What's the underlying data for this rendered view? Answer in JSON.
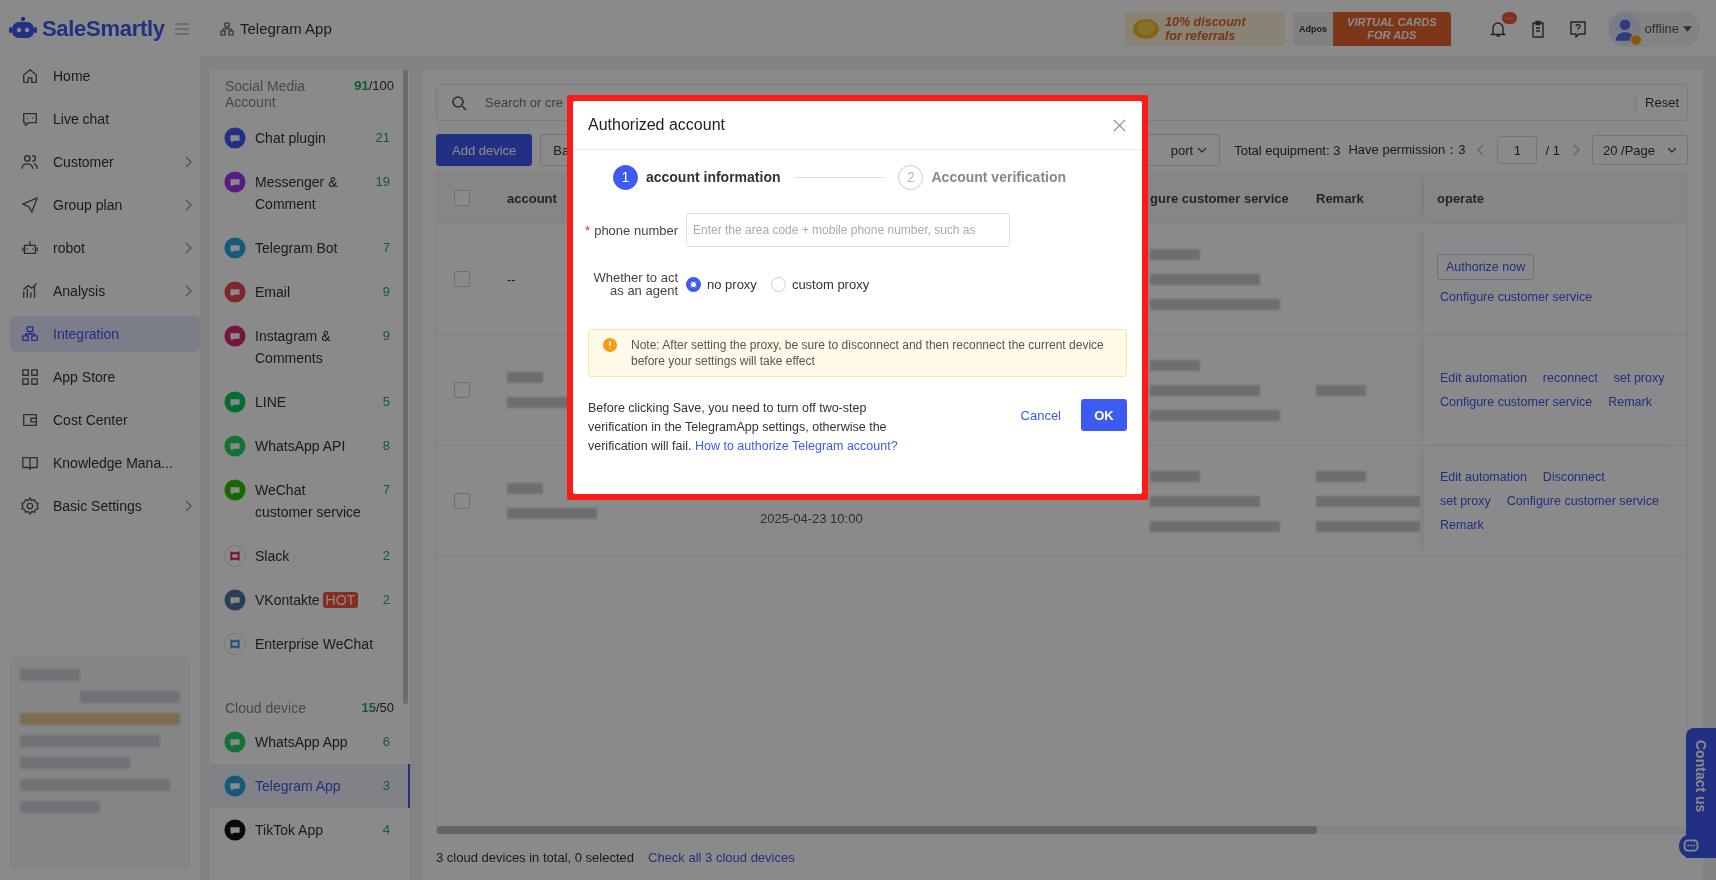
{
  "app": {
    "logo": "SaleSmartly"
  },
  "nav": [
    {
      "label": "Home",
      "expandable": false,
      "selected": false
    },
    {
      "label": "Live chat",
      "expandable": false,
      "selected": false
    },
    {
      "label": "Customer",
      "expandable": true,
      "selected": false
    },
    {
      "label": "Group plan",
      "expandable": true,
      "selected": false
    },
    {
      "label": "robot",
      "expandable": true,
      "selected": false
    },
    {
      "label": "Analysis",
      "expandable": true,
      "selected": false
    },
    {
      "label": "Integration",
      "expandable": false,
      "selected": true
    },
    {
      "label": "App Store",
      "expandable": false,
      "selected": false
    },
    {
      "label": "Cost Center",
      "expandable": false,
      "selected": false
    },
    {
      "label": "Knowledge Mana...",
      "expandable": false,
      "selected": false
    },
    {
      "label": "Basic Settings",
      "expandable": true,
      "selected": false
    }
  ],
  "top_bar": {
    "breadcrumb": "Telegram App",
    "promo_referral": [
      "10% discount",
      "for referrals"
    ],
    "promo_brand": "Adpos",
    "promo_cards": [
      "VIRTUAL CARDS",
      "FOR ADS"
    ],
    "notification_badge": "···",
    "user_status": "offline"
  },
  "channel_groups": [
    {
      "title": "Social Media Account",
      "count": "91",
      "limit": "/100",
      "items": [
        {
          "name": "Chat plugin",
          "count": "21",
          "selected": false
        },
        {
          "name": "Messenger & Comment",
          "count": "19",
          "selected": false
        },
        {
          "name": "Telegram Bot",
          "count": "7",
          "selected": false
        },
        {
          "name": "Email",
          "count": "9",
          "selected": false
        },
        {
          "name": "Instagram & Comments",
          "count": "9",
          "selected": false
        },
        {
          "name": "LINE",
          "count": "5",
          "selected": false
        },
        {
          "name": "WhatsApp API",
          "count": "8",
          "selected": false
        },
        {
          "name": "WeChat customer service",
          "count": "7",
          "selected": false
        },
        {
          "name": "Slack",
          "count": "2",
          "selected": false
        },
        {
          "name": "VKontakte",
          "badge": "HOT",
          "count": "2",
          "selected": false
        },
        {
          "name": "Enterprise WeChat",
          "selected": false
        }
      ]
    },
    {
      "title": "Cloud device",
      "count": "15",
      "limit": "/50",
      "items": [
        {
          "name": "WhatsApp App",
          "count": "6",
          "selected": false
        },
        {
          "name": "Telegram App",
          "count": "3",
          "selected": true
        },
        {
          "name": "TikTok App",
          "count": "4",
          "selected": false
        }
      ]
    }
  ],
  "toolbar": {
    "search_placeholder": "Search or cre",
    "reset": "Reset",
    "add_device": "Add device",
    "batch": "Ba",
    "export": "port",
    "total": "Total equipment: 3",
    "permission": "Have permission：3",
    "page": "1",
    "pages": "/ 1",
    "page_size": "20 /Page"
  },
  "table": {
    "all_checked": false,
    "columns": [
      "account",
      "gure customer service",
      "Remark",
      "operate"
    ],
    "rows": [
      {
        "checked": false,
        "account": "--",
        "actions": [
          [
            {
              "label": "Authorize now",
              "kind": "button"
            }
          ],
          [
            {
              "label": "Configure customer service",
              "kind": "link"
            }
          ]
        ]
      },
      {
        "checked": false,
        "actions": [
          [
            {
              "label": "Edit automation",
              "kind": "link"
            },
            {
              "label": "reconnect",
              "kind": "link"
            },
            {
              "label": "set proxy",
              "kind": "link"
            }
          ],
          [
            {
              "label": "Configure customer service",
              "kind": "link"
            },
            {
              "label": "Remark",
              "kind": "link"
            }
          ]
        ]
      },
      {
        "checked": false,
        "date": "2025-04-23 10:00",
        "actions": [
          [
            {
              "label": "Edit automation",
              "kind": "link"
            },
            {
              "label": "Disconnect",
              "kind": "link"
            }
          ],
          [
            {
              "label": "set proxy",
              "kind": "link"
            },
            {
              "label": "Configure customer service",
              "kind": "link"
            }
          ],
          [
            {
              "label": "Remark",
              "kind": "link"
            }
          ]
        ]
      }
    ]
  },
  "footer": {
    "summary": "3 cloud devices in total, 0 selected",
    "link": "Check all 3 cloud devices"
  },
  "contact": "Contact us",
  "modal": {
    "title": "Authorized account",
    "steps": [
      {
        "number": "1",
        "label": "account information",
        "selected": true
      },
      {
        "number": "2",
        "label": "Account verification",
        "selected": false
      }
    ],
    "phone": {
      "required_mark": "*",
      "label": "phone number",
      "placeholder": "Enter the area code + mobile phone number, such as"
    },
    "proxy": {
      "label": "Whether to act as an agent",
      "options": [
        {
          "label": "no proxy",
          "selected": true
        },
        {
          "label": "custom proxy",
          "selected": false
        }
      ]
    },
    "note": "Note: After setting the proxy, be sure to disconnect and then reconnect the current device before your settings will take effect",
    "footer_text": "Before clicking Save, you need to turn off two-step verification in the TelegramApp settings, otherwise the verification will fail.",
    "footer_link": "How to authorize Telegram account?",
    "cancel": "Cancel",
    "ok": "OK"
  }
}
